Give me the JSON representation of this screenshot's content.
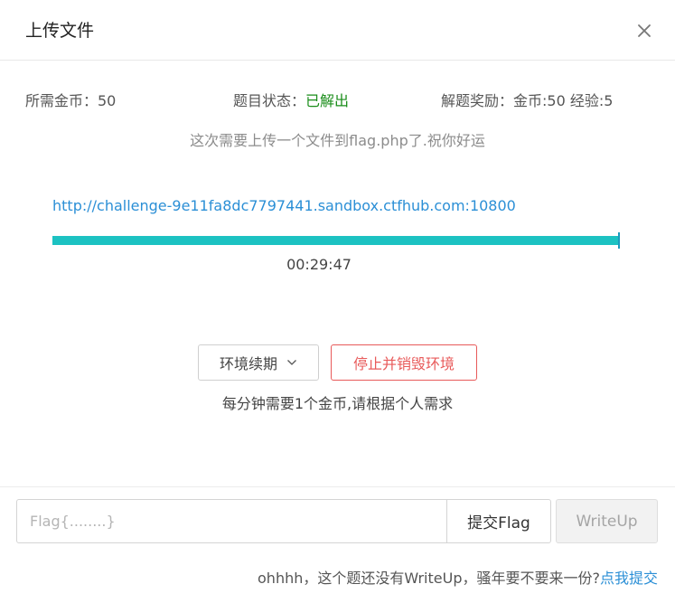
{
  "dialog": {
    "title": "上传文件",
    "close_icon": "close-icon"
  },
  "info": {
    "coin_text": "所需金币：50",
    "status_label": "题目状态：",
    "status_value": "已解出",
    "status_color": "#1a8d1a",
    "reward_text": "解题奖励：金币:50 经验:5"
  },
  "hint": "这次需要上传一个文件到flag.php了.祝你好运",
  "environment": {
    "url": "http://challenge-9e11fa8dc7797441.sandbox.ctfhub.com:10800",
    "progress_percent": 100,
    "progress_color": "#1cc2c2",
    "remaining_time": "00:29:47"
  },
  "actions": {
    "renew_label": "环境续期",
    "renew_icon": "chevron-down-icon",
    "destroy_label": "停止并销毁环境",
    "cost_note": "每分钟需要1个金币,请根据个人需求"
  },
  "footer": {
    "flag_input_placeholder": "Flag{........}",
    "flag_input_value": "",
    "submit_label": "提交Flag",
    "writeup_label": "WriteUp",
    "writeup_note": "ohhhh，这个题还没有WriteUp，骚年要不要来一份?",
    "writeup_link": "点我提交"
  },
  "colors": {
    "link": "#2b8fd6",
    "danger": "#e85a5a"
  }
}
